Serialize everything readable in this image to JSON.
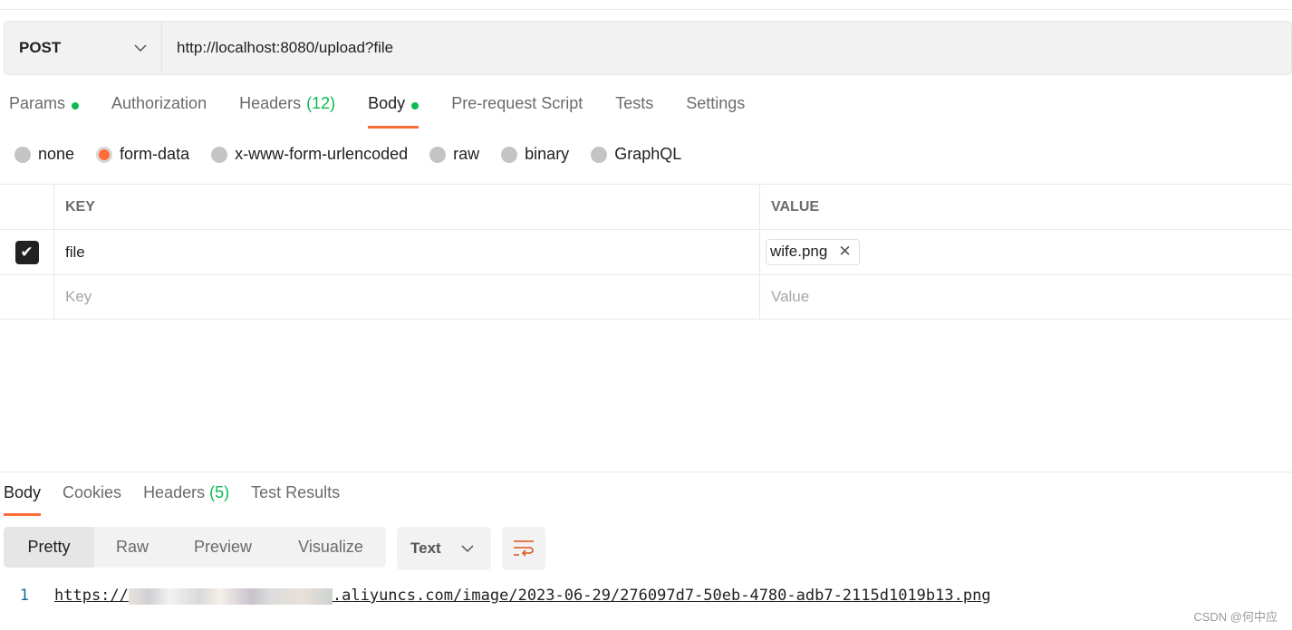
{
  "request": {
    "method": "POST",
    "url": "http://localhost:8080/upload?file"
  },
  "tabs": [
    {
      "label": "Params",
      "dot": true
    },
    {
      "label": "Authorization"
    },
    {
      "label": "Headers",
      "count": "(12)"
    },
    {
      "label": "Body",
      "dot": true,
      "active": true
    },
    {
      "label": "Pre-request Script"
    },
    {
      "label": "Tests"
    },
    {
      "label": "Settings"
    }
  ],
  "body_types": [
    {
      "label": "none"
    },
    {
      "label": "form-data",
      "selected": true
    },
    {
      "label": "x-www-form-urlencoded"
    },
    {
      "label": "raw"
    },
    {
      "label": "binary"
    },
    {
      "label": "GraphQL"
    }
  ],
  "table": {
    "key_header": "KEY",
    "value_header": "VALUE",
    "rows": [
      {
        "checked": true,
        "key": "file",
        "value": "wife.png"
      }
    ],
    "key_placeholder": "Key",
    "value_placeholder": "Value"
  },
  "response": {
    "tabs": [
      {
        "label": "Body",
        "active": true
      },
      {
        "label": "Cookies"
      },
      {
        "label": "Headers",
        "count": "(5)"
      },
      {
        "label": "Test Results"
      }
    ],
    "views": [
      "Pretty",
      "Raw",
      "Preview",
      "Visualize"
    ],
    "format": "Text",
    "line_number": "1",
    "url_prefix": "https://",
    "url_suffix": ".aliyuncs.com/image/2023-06-29/276097d7-50eb-4780-adb7-2115d1019b13.png"
  },
  "watermark": "CSDN @何中应",
  "colors": {
    "accent": "#ff6c37",
    "green": "#0cbb52"
  }
}
